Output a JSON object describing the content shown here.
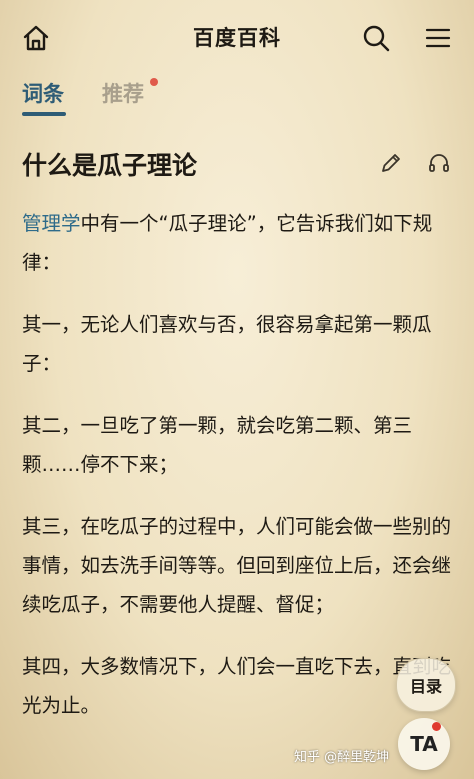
{
  "header": {
    "title": "百度百科",
    "icons": {
      "home": "home-icon",
      "search": "search-icon",
      "menu": "menu-icon"
    }
  },
  "tabs": [
    {
      "label": "词条",
      "active": true
    },
    {
      "label": "推荐",
      "active": false,
      "has_dot": true
    }
  ],
  "entry": {
    "title": "什么是瓜子理论",
    "icons": {
      "edit": "pencil-icon",
      "listen": "headphones-icon"
    }
  },
  "article": {
    "intro_link": "管理学",
    "intro_rest": "中有一个“瓜子理论”，它告诉我们如下规律：",
    "p1": "其一，无论人们喜欢与否，很容易拿起第一颗瓜子：",
    "p2": "其二，一旦吃了第一颗，就会吃第二颗、第三颗……停不下来；",
    "p3": "其三，在吃瓜子的过程中，人们可能会做一些别的事情，如去洗手间等等。但回到座位上后，还会继续吃瓜子，不需要他人提醒、督促；",
    "p4": "其四，大多数情况下，人们会一直吃下去，直到吃光为止。"
  },
  "floating": {
    "toc_label": "目录",
    "ta_label": "TA"
  },
  "watermark": "知乎 @醉里乾坤",
  "colors": {
    "accent": "#2e5c76",
    "link": "#2e6b8a",
    "dot": "#e05a4a",
    "background": "#f2e7cb"
  }
}
